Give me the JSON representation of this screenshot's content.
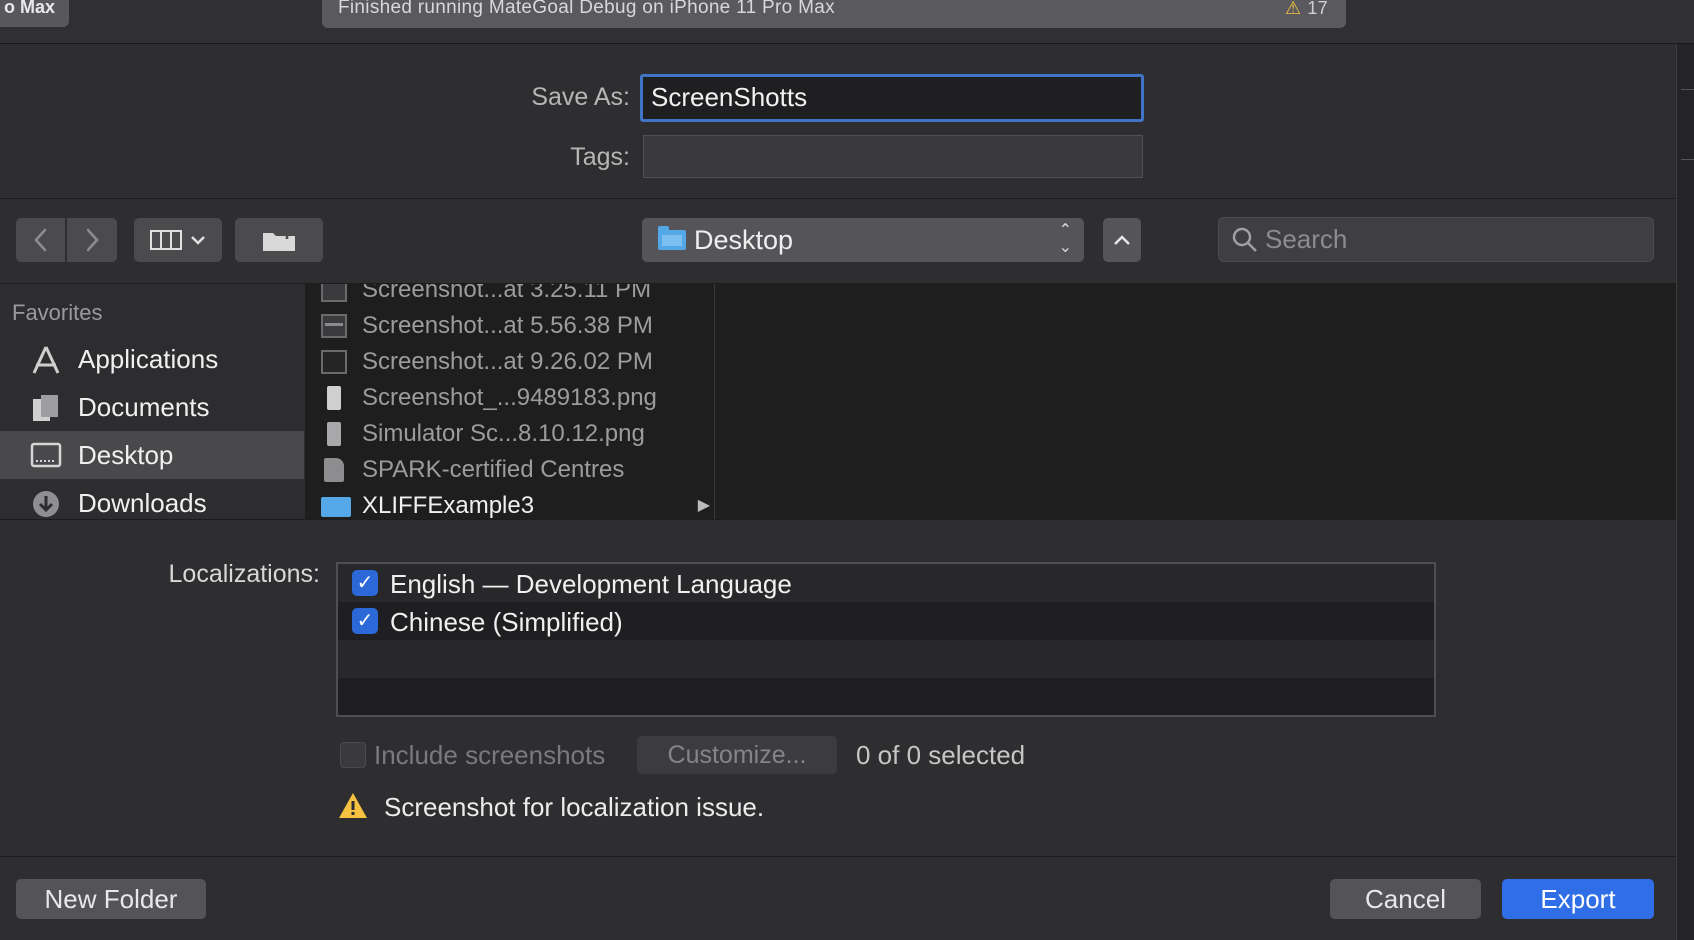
{
  "topbar": {
    "scheme_fragment": "o Max",
    "activity_text": "Finished running MateGoal Debug on iPhone 11 Pro Max",
    "warning_count": "17"
  },
  "save": {
    "save_as_label": "Save As:",
    "save_as_value": "ScreenShotts",
    "tags_label": "Tags:",
    "tags_value": ""
  },
  "toolbar": {
    "location": "Desktop",
    "search_placeholder": "Search"
  },
  "sidebar": {
    "heading": "Favorites",
    "items": [
      {
        "label": "Applications",
        "icon": "applications-icon",
        "selected": false
      },
      {
        "label": "Documents",
        "icon": "documents-icon",
        "selected": false
      },
      {
        "label": "Desktop",
        "icon": "desktop-icon",
        "selected": true
      },
      {
        "label": "Downloads",
        "icon": "downloads-icon",
        "selected": false
      }
    ]
  },
  "files": [
    {
      "name": "Screenshot...at 3.25.11 PM",
      "icon": "image-file-icon"
    },
    {
      "name": "Screenshot...at 5.56.38 PM",
      "icon": "image-file-icon"
    },
    {
      "name": "Screenshot...at 9.26.02 PM",
      "icon": "image-file-icon"
    },
    {
      "name": "Screenshot_...9489183.png",
      "icon": "phone-image-icon"
    },
    {
      "name": "Simulator Sc...8.10.12.png",
      "icon": "phone-image-icon"
    },
    {
      "name": "SPARK-certified Centres",
      "icon": "document-file-icon"
    },
    {
      "name": "XLIFFExample3",
      "icon": "folder-icon",
      "is_folder": true
    }
  ],
  "localizations": {
    "label": "Localizations:",
    "items": [
      {
        "label": "English — Development Language",
        "checked": true
      },
      {
        "label": "Chinese (Simplified)",
        "checked": true
      }
    ]
  },
  "screenshots": {
    "include_label": "Include screenshots",
    "include_checked": false,
    "customize_label": "Customize...",
    "selected_count": "0 of 0 selected",
    "warning_text": "Screenshot for localization issue."
  },
  "buttons": {
    "new_folder": "New Folder",
    "cancel": "Cancel",
    "export": "Export"
  },
  "colors": {
    "accent": "#2f6ee6",
    "warning": "#f5c242",
    "folder": "#54a8e8"
  }
}
